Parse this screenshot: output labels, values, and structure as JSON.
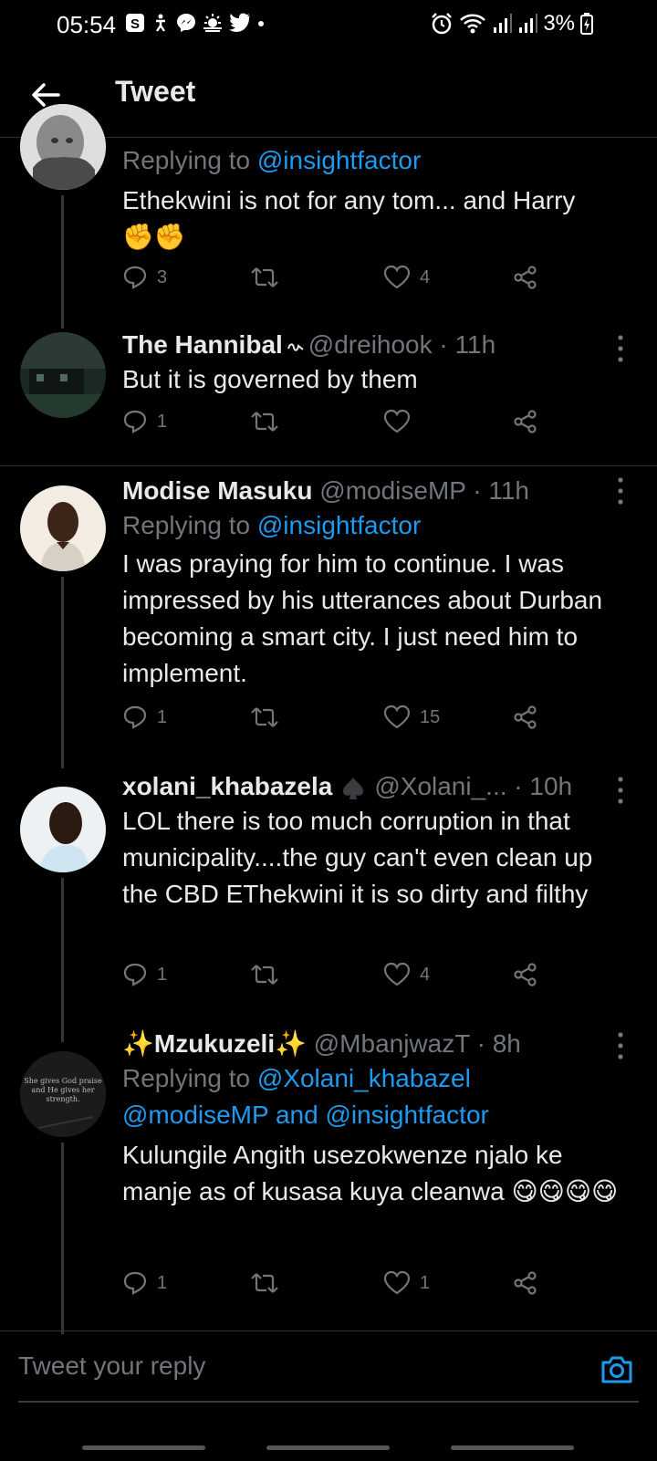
{
  "status_bar": {
    "time": "05:54",
    "battery": "3%"
  },
  "header": {
    "title": "Tweet"
  },
  "tweets": [
    {
      "reply_prefix": "Replying to ",
      "reply_handles": "@insightfactor",
      "text": "Ethekwini is not for any tom... and Harry",
      "emoji": "✊✊",
      "replies": "3",
      "retweets": "",
      "likes": "4"
    },
    {
      "name": "The Hannibal",
      "handle": "@dreihook",
      "time": "· 11h",
      "text": "But it is governed by them",
      "replies": "1",
      "retweets": "",
      "likes": ""
    },
    {
      "name": "Modise Masuku",
      "handle": "@modiseMP",
      "time": "· 11h",
      "reply_prefix": "Replying to ",
      "reply_handles": "@insightfactor",
      "text": "I was praying for him to continue. I was impressed by his utterances about Durban becoming a smart city. I just need him to implement.",
      "replies": "1",
      "retweets": "",
      "likes": "15"
    },
    {
      "name": "xolani_khabazela",
      "handle": "@Xolani_...",
      "time": "· 10h",
      "text": "LOL there is too much corruption in that municipality....the guy can't even clean up the CBD EThekwini it is so dirty and filthy",
      "replies": "1",
      "retweets": "",
      "likes": "4"
    },
    {
      "name": "✨Mzukuzeli✨",
      "handle": "@MbanjwazT",
      "time": "· 8h",
      "reply_prefix": "Replying to ",
      "reply_handle_1": "@Xolani_khabazel",
      "reply_handle_2": "@modiseMP",
      "reply_and": " and ",
      "reply_handle_3": "@insightfactor",
      "text": "Kulungile Angith usezokwenze njalo ke manje as of kusasa kuya cleanwa 😋😋😋😋",
      "avatar_caption": "She gives God praise and He gives her strength.",
      "replies": "1",
      "retweets": "",
      "likes": "1"
    }
  ],
  "reply_box": {
    "placeholder": "Tweet your reply"
  },
  "colors": {
    "background": "#000000",
    "accent": "#1d9bf0",
    "muted": "#71767b",
    "divider": "#2f3336"
  }
}
